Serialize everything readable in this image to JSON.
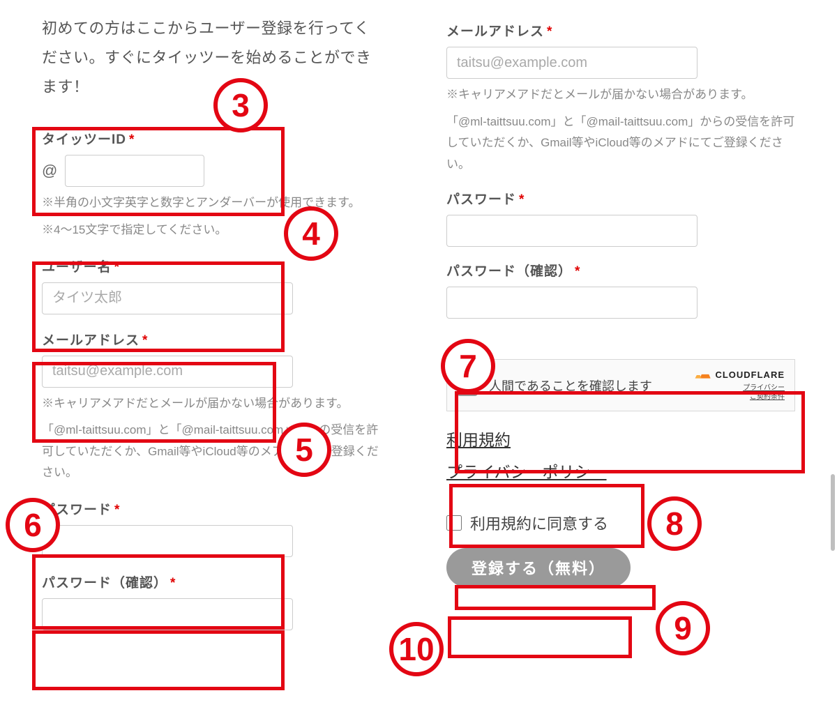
{
  "intro": "初めての方はここからユーザー登録を行ってください。すぐにタイッツーを始めることができます！",
  "left": {
    "id": {
      "label": "タイッツーID",
      "prefix": "@",
      "hint1": "※半角の小文字英字と数字とアンダーバーが使用できます。",
      "hint2": "※4〜15文字で指定してください。"
    },
    "username": {
      "label": "ユーザー名",
      "placeholder": "タイツ太郎"
    },
    "email": {
      "label": "メールアドレス",
      "placeholder": "taitsu@example.com",
      "hint1": "※キャリアメアドだとメールが届かない場合があります。",
      "hint2": "「@ml-taittsuu.com」と「@mail-taittsuu.com」からの受信を許可していただくか、Gmail等やiCloud等のメアドにてご登録ください。"
    },
    "password": {
      "label": "パスワード"
    },
    "password_confirm": {
      "label": "パスワード（確認）"
    }
  },
  "right": {
    "email": {
      "label": "メールアドレス",
      "placeholder": "taitsu@example.com",
      "hint1": "※キャリアメアドだとメールが届かない場合があります。",
      "hint2": "「@ml-taittsuu.com」と「@mail-taittsuu.com」からの受信を許可していただくか、Gmail等やiCloud等のメアドにてご登録ください。"
    },
    "password": {
      "label": "パスワード"
    },
    "password_confirm": {
      "label": "パスワード（確認）"
    },
    "captcha": {
      "text": "人間であることを確認します",
      "brand": "CLOUDFLARE",
      "privacy": "プライバシー",
      "terms": "ご契約条件"
    },
    "links": {
      "terms": "利用規約",
      "privacy": "プライバシーポリシー"
    },
    "agree": "利用規約に同意する",
    "submit": "登録する（無料）"
  },
  "annotations": {
    "n3": "3",
    "n4": "4",
    "n5": "5",
    "n6": "6",
    "n7": "7",
    "n8": "8",
    "n9": "9",
    "n10": "10"
  }
}
